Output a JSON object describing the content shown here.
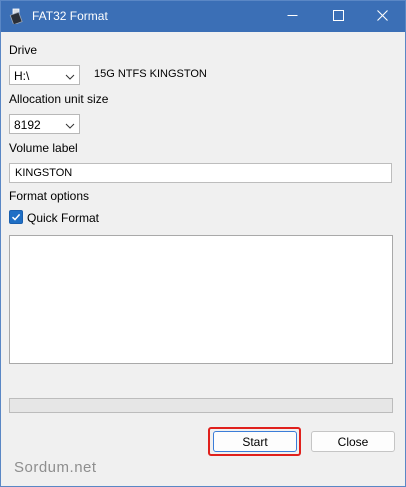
{
  "window": {
    "title": "FAT32 Format",
    "accent_color": "#3b6fb6",
    "icons": {
      "app": "usb-drive-icon",
      "minimize": "minimize-icon",
      "maximize": "maximize-icon",
      "close": "close-icon"
    }
  },
  "drive": {
    "label": "Drive",
    "selected": "H:\\",
    "info": "15G NTFS KINGSTON"
  },
  "allocation": {
    "label": "Allocation unit size",
    "selected": "8192"
  },
  "volume": {
    "label": "Volume label",
    "value": "KINGSTON"
  },
  "format_options": {
    "label": "Format options",
    "quick_format_label": "Quick Format",
    "quick_format_checked": true
  },
  "progress": {
    "value": 0
  },
  "buttons": {
    "start": "Start",
    "close": "Close",
    "highlight_color": "#e0201c"
  },
  "watermark": "Sordum.net"
}
